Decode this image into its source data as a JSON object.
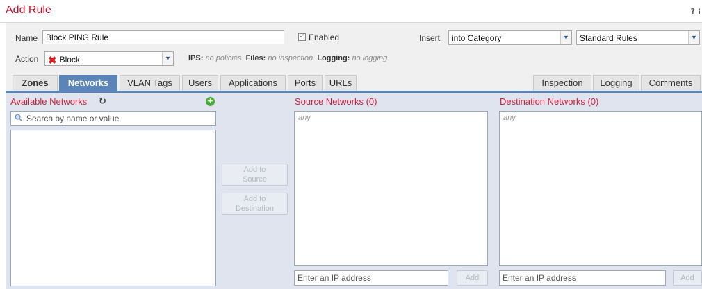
{
  "dialog": {
    "title": "Add Rule",
    "help_label": "? ⁝"
  },
  "form": {
    "name_label": "Name",
    "name_value": "Block PING Rule",
    "enabled_label": "Enabled",
    "enabled_checked": true,
    "insert_label": "Insert",
    "insert_value": "into Category",
    "category_value": "Standard Rules",
    "action_label": "Action",
    "action_value": "Block",
    "ips_label": "IPS:",
    "ips_value": "no policies",
    "files_label": "Files:",
    "files_value": "no inspection",
    "logging_label": "Logging:",
    "logging_value": "no logging"
  },
  "tabs_left": [
    "Zones",
    "Networks",
    "VLAN Tags",
    "Users",
    "Applications",
    "Ports",
    "URLs"
  ],
  "tabs_right": [
    "Inspection",
    "Logging",
    "Comments"
  ],
  "active_tab": "Networks",
  "networks": {
    "available_title": "Available Networks",
    "search_placeholder": "Search by name or value",
    "add_to_source": "Add to\nSource",
    "add_to_destination": "Add to\nDestination",
    "source_title": "Source Networks (0)",
    "destination_title": "Destination Networks (0)",
    "any_placeholder": "any",
    "ip_placeholder": "Enter an IP address",
    "add_label": "Add"
  },
  "colors": {
    "accent": "#c8102e",
    "tab_active": "#5b84b9",
    "panel": "#dfe4ef"
  }
}
